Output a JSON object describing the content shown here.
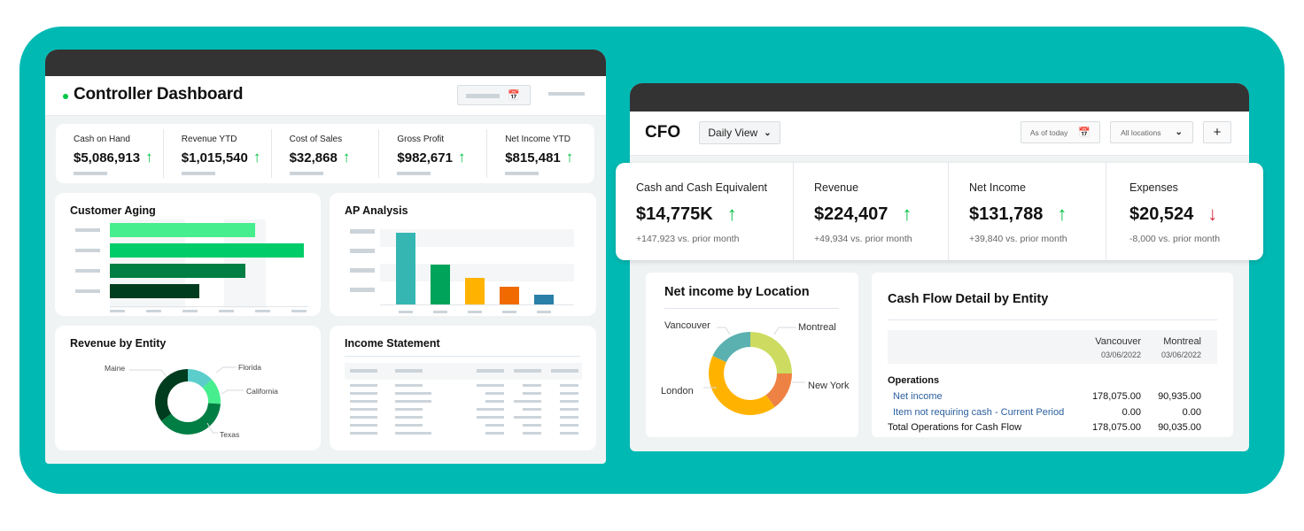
{
  "colors": {
    "background_teal": "#00b9b3",
    "titlebar": "#333333",
    "positive": "#00c040",
    "negative": "#d6283a",
    "link": "#2a5e9e"
  },
  "controller": {
    "title": "Controller Dashboard",
    "date_picker_icon": "calendar-icon",
    "kpis": [
      {
        "label": "Cash on Hand",
        "value": "$5,086,913",
        "trend": "up"
      },
      {
        "label": "Revenue YTD",
        "value": "$1,015,540",
        "trend": "up"
      },
      {
        "label": "Cost of Sales",
        "value": "$32,868",
        "trend": "up"
      },
      {
        "label": "Gross Profit",
        "value": "$982,671",
        "trend": "up"
      },
      {
        "label": "Net Income YTD",
        "value": "$815,481",
        "trend": "up"
      }
    ],
    "customer_aging": {
      "title": "Customer Aging",
      "bars": [
        {
          "relative_value": 0.75,
          "color": "#47ee8d"
        },
        {
          "relative_value": 1.0,
          "color": "#00cc6a"
        },
        {
          "relative_value": 0.7,
          "color": "#007e43"
        },
        {
          "relative_value": 0.46,
          "color": "#003d1e"
        }
      ]
    },
    "ap_analysis": {
      "title": "AP Analysis",
      "bars": [
        {
          "relative_value": 1.0,
          "color": "#36b6b3"
        },
        {
          "relative_value": 0.55,
          "color": "#00a35a"
        },
        {
          "relative_value": 0.37,
          "color": "#ffb300"
        },
        {
          "relative_value": 0.25,
          "color": "#f06a00"
        },
        {
          "relative_value": 0.13,
          "color": "#2a7fa8"
        }
      ]
    },
    "revenue_by_entity": {
      "title": "Revenue by Entity",
      "segments": [
        {
          "label": "Florida",
          "share": 0.13,
          "color": "#5bcdcb"
        },
        {
          "label": "California",
          "share": 0.13,
          "color": "#47ee8d"
        },
        {
          "label": "Texas",
          "share": 0.39,
          "color": "#007e43"
        },
        {
          "label": "Maine",
          "share": 0.35,
          "color": "#003d1e"
        }
      ]
    },
    "income_statement": {
      "title": "Income Statement"
    }
  },
  "cfo": {
    "title": "CFO",
    "view_select": "Daily View",
    "date_filter": "As of today",
    "location_filter": "All locations",
    "add_label": "+",
    "kpis": [
      {
        "label": "Cash and Cash Equivalent",
        "value": "$14,775K",
        "trend": "up",
        "delta": "+147,923 vs. prior month"
      },
      {
        "label": "Revenue",
        "value": "$224,407",
        "trend": "up",
        "delta": "+49,934 vs. prior month"
      },
      {
        "label": "Net Income",
        "value": "$131,788",
        "trend": "up",
        "delta": "+39,840 vs. prior month"
      },
      {
        "label": "Expenses",
        "value": "$20,524",
        "trend": "down",
        "delta": "-8,000 vs. prior month"
      }
    ],
    "net_income_by_location": {
      "title": "Net income by Location",
      "segments": [
        {
          "label": "Montreal",
          "share": 0.25,
          "color": "#cddb60"
        },
        {
          "label": "New York",
          "share": 0.15,
          "color": "#ee8244"
        },
        {
          "label": "London",
          "share": 0.42,
          "color": "#ffb300"
        },
        {
          "label": "Vancouver",
          "share": 0.18,
          "color": "#5bb1b0"
        }
      ]
    },
    "cash_flow": {
      "title": "Cash Flow Detail by Entity",
      "columns": [
        {
          "name": "Vancouver",
          "date": "03/06/2022"
        },
        {
          "name": "Montreal",
          "date": "03/06/2022"
        }
      ],
      "section": "Operations",
      "rows": [
        {
          "label": "Net income",
          "values": [
            "178,075.00",
            "90,935.00"
          ],
          "link": true
        },
        {
          "label": "Item not requiring cash - Current Period",
          "values": [
            "0.00",
            "0.00"
          ],
          "link": true
        },
        {
          "label": "Total Operations for Cash Flow",
          "values": [
            "178,075.00",
            "90,035.00"
          ],
          "link": false
        }
      ]
    }
  }
}
